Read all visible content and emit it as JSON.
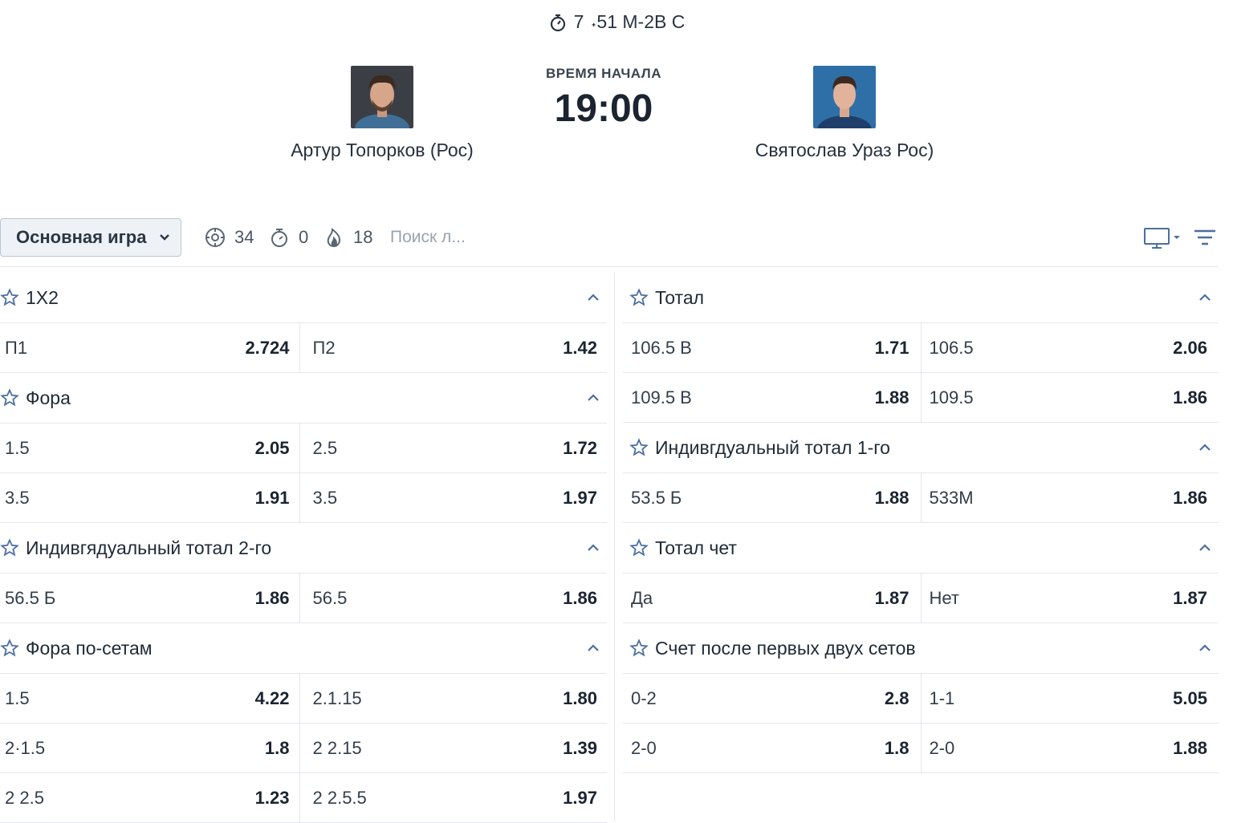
{
  "header": {
    "timer": "7  ˖51 M-2B C",
    "start_label": "ВРЕМЯ НАЧАЛА",
    "start_time": "19:00",
    "player1": "Артур Топорков (Рос)",
    "player2": "Святослав Ураз Рос)"
  },
  "toolbar": {
    "dropdown_label": "Основная игра",
    "count_markets": "34",
    "count_special": "0",
    "count_bets": "18",
    "search_placeholder": "Поиск л..."
  },
  "left": [
    {
      "title": "1X2",
      "rows": [
        [
          {
            "l": "П1",
            "o": "2.724"
          },
          {
            "l": "П2",
            "o": "1.42"
          }
        ]
      ]
    },
    {
      "title": "Фора",
      "rows": [
        [
          {
            "l": "1.5",
            "o": "2.05"
          },
          {
            "l": "2.5",
            "o": "1.72"
          }
        ],
        [
          {
            "l": "3.5",
            "o": "1.91"
          },
          {
            "l": "3.5",
            "o": "1.97"
          }
        ]
      ]
    },
    {
      "title": "Индивгядуальный тотал 2-го",
      "rows": [
        [
          {
            "l": "56.5 Б",
            "o": "1.86"
          },
          {
            "l": "56.5",
            "o": "1.86"
          }
        ]
      ]
    },
    {
      "title": "Фора по-сетам",
      "rows": [
        [
          {
            "l": "1.5",
            "o": "4.22"
          },
          {
            "l": "2.1.15",
            "o": "1.80"
          }
        ],
        [
          {
            "l": "2·1.5",
            "o": "1.8"
          },
          {
            "l": "2 2.15",
            "o": "1.39"
          }
        ],
        [
          {
            "l": "2 2.5",
            "o": "1.23"
          },
          {
            "l": "2 2.5.5",
            "o": "1.97"
          }
        ]
      ]
    }
  ],
  "right": [
    {
      "title": "Тотал",
      "rows": [
        [
          {
            "l": "106.5 В",
            "o": "1.71"
          },
          {
            "l": "106.5",
            "o": "2.06"
          }
        ],
        [
          {
            "l": "109.5 В",
            "o": "1.88"
          },
          {
            "l": "109.5",
            "o": "1.86"
          }
        ]
      ]
    },
    {
      "title": "Индивгдуальный тотал 1-го",
      "rows": [
        [
          {
            "l": "53.5 Б",
            "o": "1.88"
          },
          {
            "l": "533M",
            "o": "1.86"
          }
        ]
      ]
    },
    {
      "title": "Тотал чет",
      "rows": [
        [
          {
            "l": "Да",
            "o": "1.87"
          },
          {
            "l": "Нет",
            "o": "1.87"
          }
        ]
      ]
    },
    {
      "title": "Счет после первых двух сетов",
      "rows": [
        [
          {
            "l": "0-2",
            "o": "2.8"
          },
          {
            "l": "1-1",
            "o": "5.05"
          }
        ],
        [
          {
            "l": "2-0",
            "o": "1.8"
          },
          {
            "l": "2-0",
            "o": "1.88"
          }
        ]
      ]
    }
  ],
  "colors": {
    "accent": "#3d5a80",
    "border": "#e3e7ec",
    "text": "#1f2a36"
  }
}
